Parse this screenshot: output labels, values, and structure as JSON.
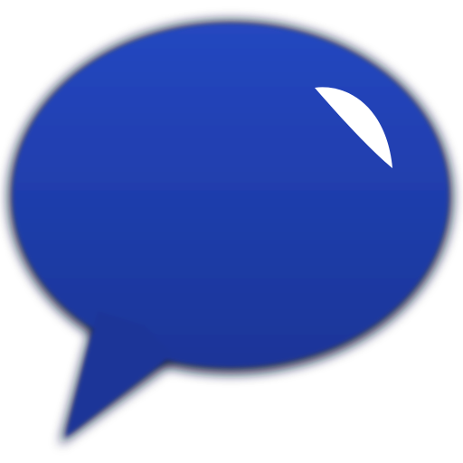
{
  "icon": {
    "name": "speech-bubble-icon",
    "colors": {
      "fill_top": "#2547c0",
      "fill_bottom": "#1a3598",
      "edge_shadow": "#0a163f",
      "highlight": "#ffffff",
      "background": "#ffffff"
    }
  }
}
